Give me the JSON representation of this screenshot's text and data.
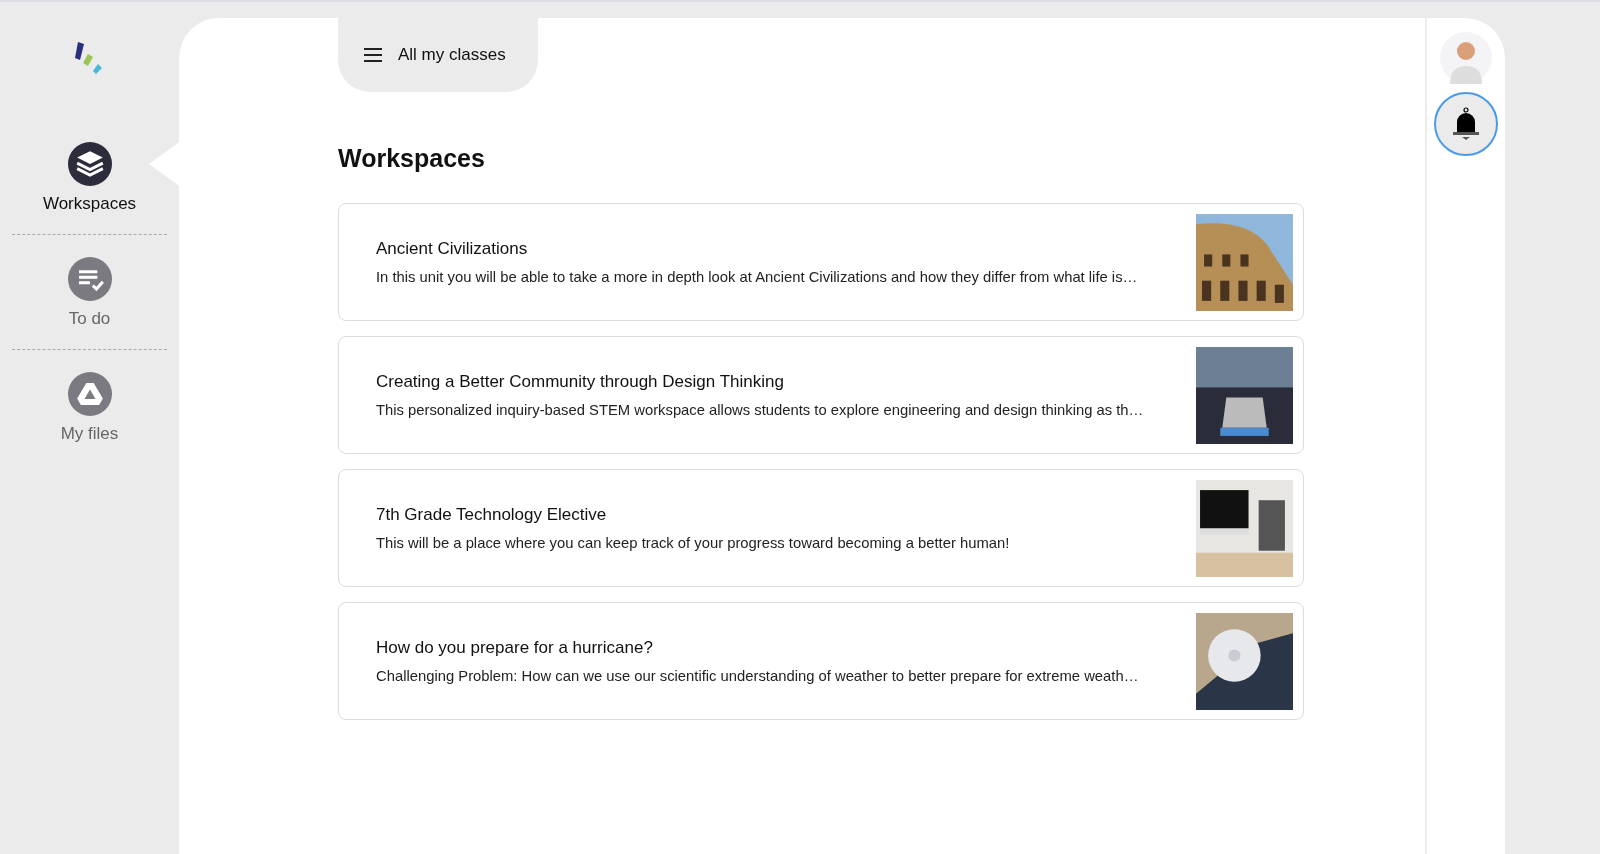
{
  "sidebar": {
    "items": [
      {
        "label": "Workspaces",
        "kind": "layers",
        "selected": true
      },
      {
        "label": "To do",
        "kind": "todo",
        "selected": false
      },
      {
        "label": "My files",
        "kind": "drive",
        "selected": false
      }
    ]
  },
  "class_switcher": {
    "label": "All my classes"
  },
  "heading": "Workspaces",
  "workspaces": [
    {
      "title": "Ancient Civilizations",
      "description": "In this unit you will be able to take a more in depth look at Ancient Civilizations and how they differ from what life is…",
      "kind": "colosseum"
    },
    {
      "title": "Creating a Better Community through Design Thinking",
      "description": "This personalized inquiry-based STEM workspace allows students to explore engineering and design thinking as th…",
      "kind": "laptop"
    },
    {
      "title": "7th Grade Technology Elective",
      "description": "This will be a place where you can keep track of your progress toward becoming a better human!",
      "kind": "desk"
    },
    {
      "title": "How do you prepare for a hurricane?",
      "description": "Challenging Problem: How can we use our scientific understanding of weather to better prepare for extreme weath…",
      "kind": "hurricane"
    }
  ]
}
